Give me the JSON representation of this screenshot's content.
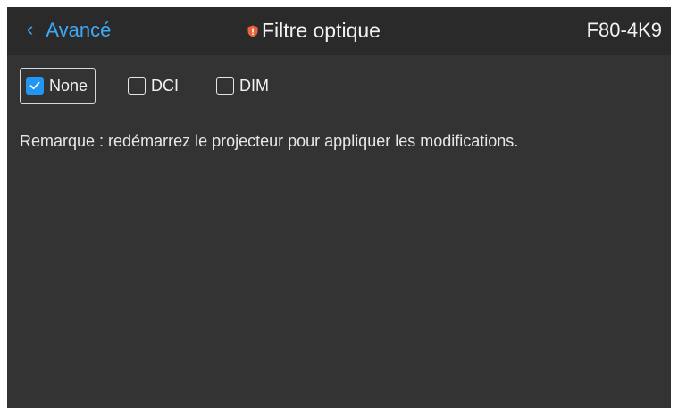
{
  "header": {
    "back_label": "Avancé",
    "title": "Filtre optique",
    "model": "F80-4K9",
    "back_icon": "chevron-left-icon",
    "title_icon": "shield-warning-icon"
  },
  "options": [
    {
      "label": "None",
      "checked": true
    },
    {
      "label": "DCI",
      "checked": false
    },
    {
      "label": "DIM",
      "checked": false
    }
  ],
  "note": "Remarque : redémarrez le projecteur pour appliquer les modifications.",
  "colors": {
    "accent": "#3fa9f5",
    "checkbox_checked": "#2196f3",
    "title_icon": "#e8643c",
    "background": "#333333",
    "header_background": "#2a2a2a"
  }
}
